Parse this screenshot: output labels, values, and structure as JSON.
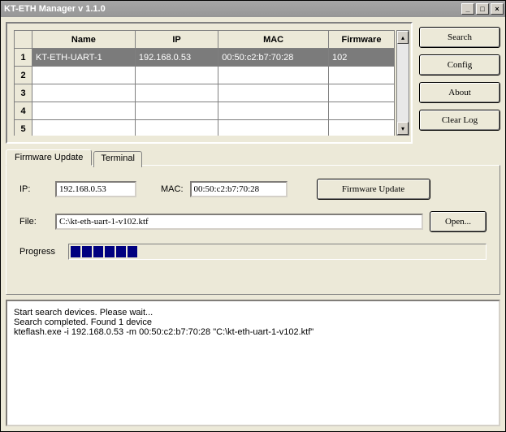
{
  "window": {
    "title": "KT-ETH Manager v 1.1.0"
  },
  "titlebar_buttons": {
    "min": "_",
    "max": "□",
    "close": "×"
  },
  "grid": {
    "headers": [
      "Name",
      "IP",
      "MAC",
      "Firmware"
    ],
    "rows": [
      {
        "num": "1",
        "name": "KT-ETH-UART-1",
        "ip": "192.168.0.53",
        "mac": "00:50:c2:b7:70:28",
        "fw": "102",
        "selected": true
      },
      {
        "num": "2",
        "name": "",
        "ip": "",
        "mac": "",
        "fw": "",
        "selected": false
      },
      {
        "num": "3",
        "name": "",
        "ip": "",
        "mac": "",
        "fw": "",
        "selected": false
      },
      {
        "num": "4",
        "name": "",
        "ip": "",
        "mac": "",
        "fw": "",
        "selected": false
      },
      {
        "num": "5",
        "name": "",
        "ip": "",
        "mac": "",
        "fw": "",
        "selected": false
      }
    ]
  },
  "buttons": {
    "search": "Search",
    "config": "Config",
    "about": "About",
    "clearlog": "Clear Log"
  },
  "tabs": {
    "firmware": "Firmware Update",
    "terminal": "Terminal"
  },
  "fw": {
    "ip_label": "IP:",
    "ip_value": "192.168.0.53",
    "mac_label": "MAC:",
    "mac_value": "00:50:c2:b7:70:28",
    "update_btn": "Firmware Update",
    "file_label": "File:",
    "file_value": "C:\\kt-eth-uart-1-v102.ktf",
    "open_btn": "Open...",
    "progress_label": "Progress",
    "progress_blocks": 6
  },
  "log": {
    "text": "Start search devices. Please wait...\nSearch completed. Found 1 device\nkteflash.exe -i 192.168.0.53 -m 00:50:c2:b7:70:28 \"C:\\kt-eth-uart-1-v102.ktf\""
  }
}
